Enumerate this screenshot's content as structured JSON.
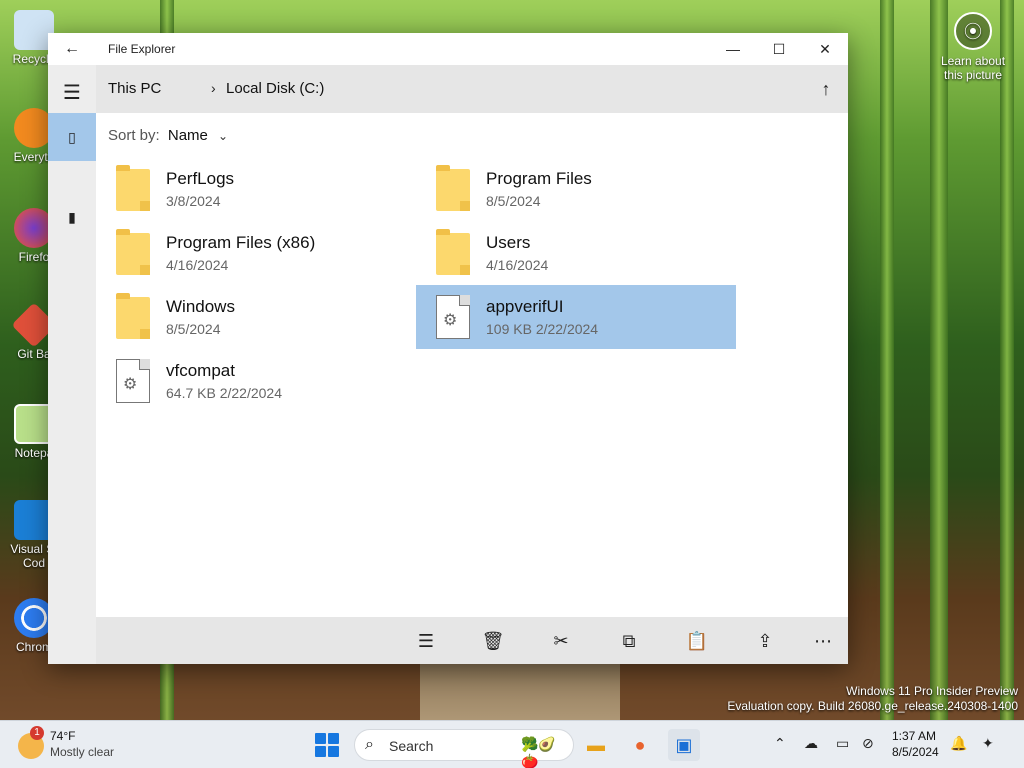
{
  "desktop": {
    "icons": [
      {
        "label": "Recycle"
      },
      {
        "label": "Everyth"
      },
      {
        "label": "Firefo"
      },
      {
        "label": "Git Ba"
      },
      {
        "label": "Notepa"
      },
      {
        "label": "Visual St"
      },
      {
        "label": "Cod"
      },
      {
        "label": "Chrom"
      }
    ],
    "learn_line1": "Learn about",
    "learn_line2": "this picture",
    "watermark_line1": "Windows 11 Pro Insider Preview",
    "watermark_line2": "Evaluation copy. Build 26080.ge_release.240308-1400"
  },
  "window": {
    "title": "File Explorer",
    "back_icon": "back-arrow-icon",
    "breadcrumb": [
      "This PC",
      "Local Disk (C:)"
    ],
    "sort_label": "Sort by:",
    "sort_value": "Name",
    "items": [
      {
        "name": "PerfLogs",
        "meta": "3/8/2024",
        "kind": "folder",
        "selected": false
      },
      {
        "name": "Program Files",
        "meta": "8/5/2024",
        "kind": "folder",
        "selected": false
      },
      {
        "name": "Program Files (x86)",
        "meta": "4/16/2024",
        "kind": "folder",
        "selected": false
      },
      {
        "name": "Users",
        "meta": "4/16/2024",
        "kind": "folder",
        "selected": false
      },
      {
        "name": "Windows",
        "meta": "8/5/2024",
        "kind": "folder",
        "selected": false
      },
      {
        "name": "appverifUI",
        "meta": "109 KB  2/22/2024",
        "kind": "file",
        "selected": true
      },
      {
        "name": "vfcompat",
        "meta": "64.7 KB  2/22/2024",
        "kind": "file",
        "selected": false
      }
    ],
    "accent": "#a3c7ea",
    "folder_color": "#fcd86d"
  },
  "taskbar": {
    "weather_badge": "1",
    "weather_temp": "74°F",
    "weather_desc": "Mostly clear",
    "search_text": "Search",
    "clock_time": "1:37 AM",
    "clock_date": "8/5/2024"
  }
}
